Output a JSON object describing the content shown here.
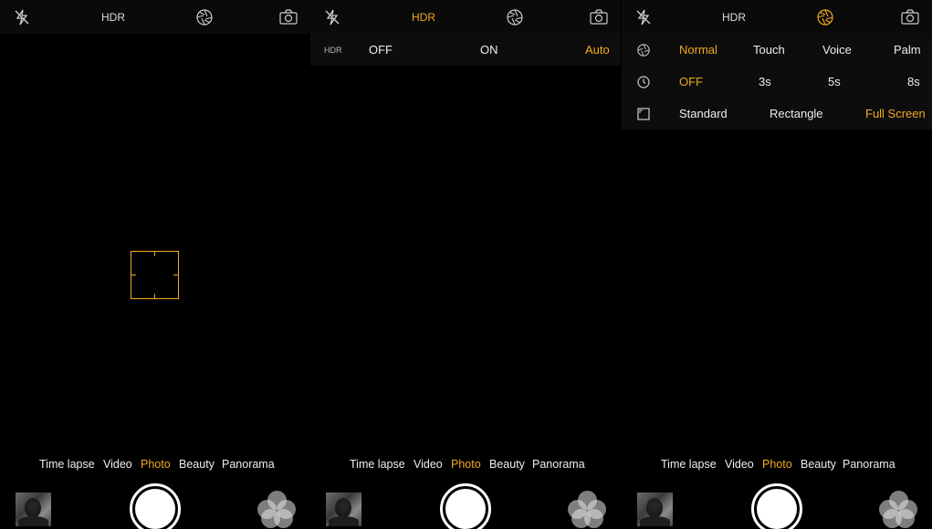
{
  "colors": {
    "accent": "#f2a91c",
    "background": "#000000",
    "text": "#eeeeee"
  },
  "top_bar": {
    "hdr_label": "HDR",
    "icons": [
      "flash-off-icon",
      "aperture-icon",
      "switch-camera-icon"
    ]
  },
  "hdr_menu": {
    "label": "HDR",
    "options": [
      "OFF",
      "ON",
      "Auto"
    ],
    "selected": "Auto"
  },
  "settings_menu": {
    "shutter_row": {
      "icon": "aperture-icon",
      "options": [
        "Normal",
        "Touch",
        "Voice",
        "Palm"
      ],
      "selected": "Normal"
    },
    "timer_row": {
      "icon": "timer-icon",
      "options": [
        "OFF",
        "3s",
        "5s",
        "8s"
      ],
      "selected": "OFF"
    },
    "ratio_row": {
      "icon": "aspect-ratio-icon",
      "options": [
        "Standard",
        "Rectangle",
        "Full Screen"
      ],
      "selected": "Full Screen"
    }
  },
  "modes": [
    "Time lapse",
    "Video",
    "Photo",
    "Beauty",
    "Panorama"
  ],
  "selected_mode": "Photo",
  "bottom_controls": {
    "gallery_thumbnail": "gallery-thumbnail",
    "shutter": "shutter-button",
    "filters": "filters-icon"
  }
}
